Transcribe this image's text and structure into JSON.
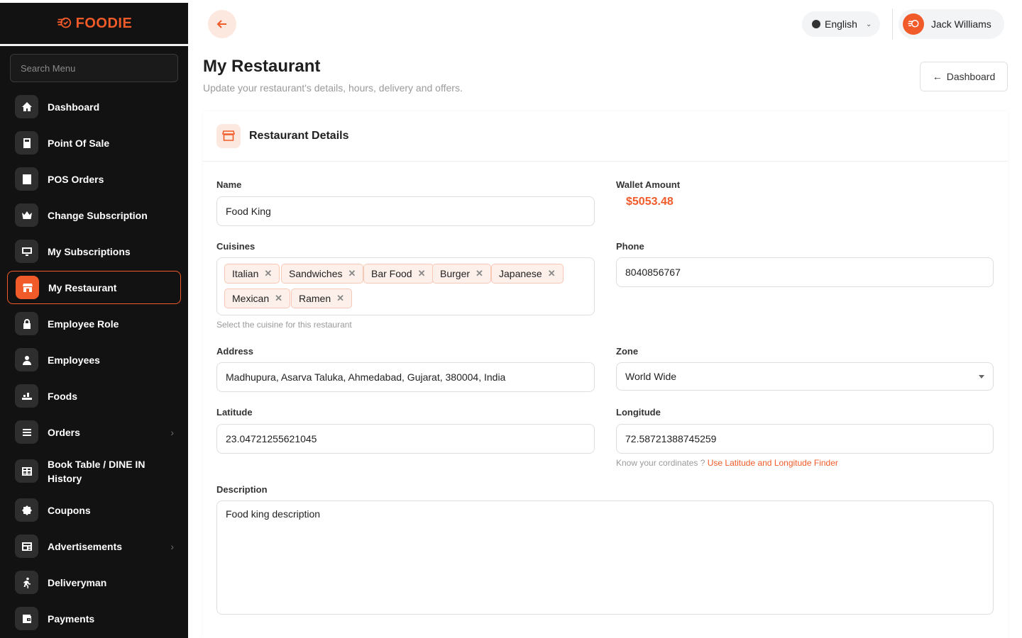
{
  "app": {
    "logo": "FOODIE",
    "brand_color": "#f15a29"
  },
  "sidebar": {
    "search_placeholder": "Search Menu",
    "items": [
      {
        "label": "Dashboard",
        "icon": "home-icon"
      },
      {
        "label": "Point Of Sale",
        "icon": "calculator-icon"
      },
      {
        "label": "POS Orders",
        "icon": "receipt-icon"
      },
      {
        "label": "Change Subscription",
        "icon": "crown-icon"
      },
      {
        "label": "My Subscriptions",
        "icon": "monitor-icon"
      },
      {
        "label": "My Restaurant",
        "icon": "store-icon",
        "active": true
      },
      {
        "label": "Employee Role",
        "icon": "lock-icon"
      },
      {
        "label": "Employees",
        "icon": "person-icon"
      },
      {
        "label": "Foods",
        "icon": "food-icon"
      },
      {
        "label": "Orders",
        "icon": "list-icon",
        "has_children": true
      },
      {
        "label": "Book Table / DINE IN History",
        "icon": "table-icon"
      },
      {
        "label": "Coupons",
        "icon": "coupon-icon"
      },
      {
        "label": "Advertisements",
        "icon": "ad-icon",
        "has_children": true
      },
      {
        "label": "Deliveryman",
        "icon": "runner-icon"
      },
      {
        "label": "Payments",
        "icon": "wallet-icon"
      }
    ]
  },
  "topbar": {
    "language": "English",
    "user_name": "Jack Williams"
  },
  "page": {
    "title": "My Restaurant",
    "subtitle": "Update your restaurant's details, hours, delivery and offers.",
    "dashboard_button": "Dashboard"
  },
  "card": {
    "title": "Restaurant Details",
    "name": {
      "label": "Name",
      "value": "Food King"
    },
    "wallet": {
      "label": "Wallet Amount",
      "value": "$5053.48"
    },
    "cuisines": {
      "label": "Cuisines",
      "chips": [
        "Italian",
        "Sandwiches",
        "Bar Food",
        "Burger",
        "Japanese",
        "Mexican",
        "Ramen"
      ],
      "hint": "Select the cuisine for this restaurant"
    },
    "phone": {
      "label": "Phone",
      "value": "8040856767"
    },
    "address": {
      "label": "Address",
      "value": "Madhupura, Asarva Taluka, Ahmedabad, Gujarat, 380004, India"
    },
    "zone": {
      "label": "Zone",
      "value": "World Wide"
    },
    "latitude": {
      "label": "Latitude",
      "value": "23.04721255621045"
    },
    "longitude": {
      "label": "Longitude",
      "value": "72.58721388745259"
    },
    "coords_hint": "Know your cordinates ?",
    "coords_link": "Use Latitude and Longitude Finder",
    "description": {
      "label": "Description",
      "value": "Food king description"
    }
  }
}
